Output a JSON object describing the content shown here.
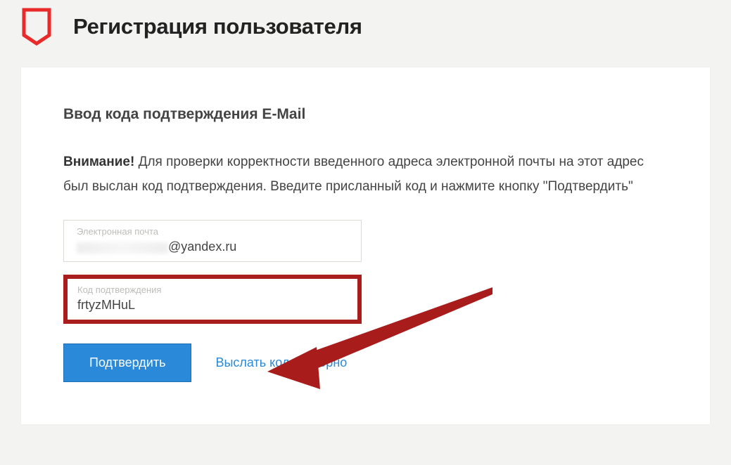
{
  "header": {
    "title": "Регистрация пользователя"
  },
  "section": {
    "heading": "Ввод кода подтверждения E-Mail",
    "attention_label": "Внимание!",
    "instruction_text": " Для проверки корректности введенного адреса электронной почты на этот адрес был выслан код подтверждения. Введите присланный код и нажмите кнопку \"Подтвердить\""
  },
  "email_field": {
    "label": "Электронная почта",
    "domain_part": "@yandex.ru"
  },
  "code_field": {
    "label": "Код подтверждения",
    "value": "frtyzMHuL"
  },
  "actions": {
    "confirm_label": "Подтвердить",
    "resend_label": "Выслать код повторно"
  }
}
